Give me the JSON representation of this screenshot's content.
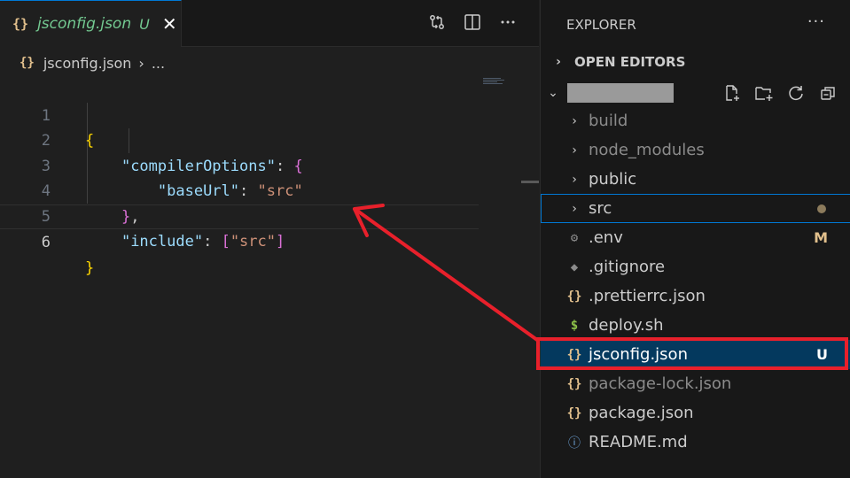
{
  "tab": {
    "icon": "{}",
    "filename": "jsconfig.json",
    "status": "U",
    "close": "✕"
  },
  "editor_actions": [
    "open-changes-icon",
    "split-editor-icon",
    "more-actions-icon"
  ],
  "breadcrumb": {
    "icon": "{}",
    "file": "jsconfig.json",
    "separator": "›",
    "more": "..."
  },
  "code": {
    "line_numbers": [
      "1",
      "2",
      "3",
      "4",
      "5",
      "6"
    ],
    "l1_brace": "{",
    "l2_key": "\"compilerOptions\"",
    "l2_colon": ": ",
    "l2_brace": "{",
    "l3_key": "\"baseUrl\"",
    "l3_colon": ": ",
    "l3_value": "\"src\"",
    "l4_brace": "}",
    "l4_comma": ",",
    "l5_key": "\"include\"",
    "l5_colon": ": ",
    "l5_open": "[",
    "l5_value": "\"src\"",
    "l5_close": "]",
    "l6_brace": "}"
  },
  "explorer": {
    "title": "EXPLORER",
    "more": "···",
    "open_editors": "OPEN EDITORS",
    "workspace_actions": [
      "new-file-icon",
      "new-folder-icon",
      "refresh-icon",
      "collapse-all-icon"
    ],
    "items": [
      {
        "label": "build",
        "icon": "chevron-right-icon",
        "dim": true
      },
      {
        "label": "node_modules",
        "icon": "chevron-right-icon",
        "dim": true
      },
      {
        "label": "public",
        "icon": "chevron-right-icon"
      },
      {
        "label": "src",
        "icon": "chevron-right-icon"
      },
      {
        "label": ".env",
        "icon": "gear-icon",
        "badge": "M"
      },
      {
        "label": ".gitignore",
        "icon": "git-icon"
      },
      {
        "label": ".prettierrc.json",
        "icon": "json-icon"
      },
      {
        "label": "deploy.sh",
        "icon": "shell-icon"
      },
      {
        "label": "jsconfig.json",
        "icon": "json-icon",
        "badge": "U",
        "selected": true
      },
      {
        "label": "package-lock.json",
        "icon": "json-icon",
        "dim": true
      },
      {
        "label": "package.json",
        "icon": "json-icon"
      },
      {
        "label": "README.md",
        "icon": "info-icon"
      }
    ]
  },
  "glyphs": {
    "chevron_right": "›",
    "chevron_down": "⌄",
    "json": "{}",
    "shell": "$",
    "info": "ⓘ",
    "gear": "⚙",
    "git": "◆"
  },
  "colors": {
    "accent": "#0078d4",
    "untracked": "#73c991",
    "annotation_red": "#e8202b",
    "selection": "#04395e"
  }
}
